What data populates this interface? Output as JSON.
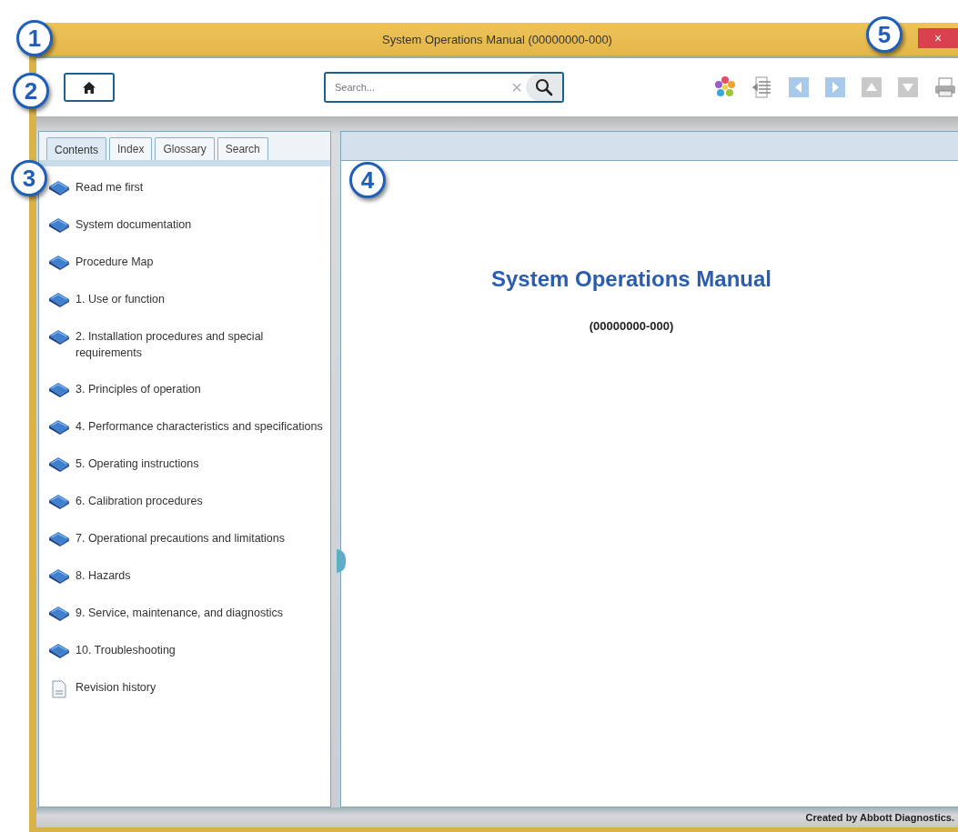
{
  "window": {
    "title": "System Operations Manual (00000000-000)",
    "close": "×"
  },
  "callouts": [
    "1",
    "2",
    "3",
    "4",
    "5"
  ],
  "search": {
    "placeholder": "Search...",
    "clear": "×"
  },
  "tabs": [
    {
      "label": "Contents",
      "selected": true
    },
    {
      "label": "Index",
      "selected": false
    },
    {
      "label": "Glossary",
      "selected": false
    },
    {
      "label": "Search",
      "selected": false
    }
  ],
  "contents": [
    {
      "label": "Read me first",
      "kind": "book"
    },
    {
      "label": "System documentation",
      "kind": "book"
    },
    {
      "label": "Procedure Map",
      "kind": "book"
    },
    {
      "label": "1. Use or function",
      "kind": "book"
    },
    {
      "label": "2. Installation procedures and special requirements",
      "kind": "book"
    },
    {
      "label": "3. Principles of operation",
      "kind": "book"
    },
    {
      "label": "4. Performance characteristics and specifications",
      "kind": "book"
    },
    {
      "label": "5. Operating instructions",
      "kind": "book"
    },
    {
      "label": "6. Calibration procedures",
      "kind": "book"
    },
    {
      "label": "7. Operational precautions and limitations",
      "kind": "book"
    },
    {
      "label": "8. Hazards",
      "kind": "book"
    },
    {
      "label": "9. Service, maintenance, and diagnostics",
      "kind": "book"
    },
    {
      "label": "10. Troubleshooting",
      "kind": "book"
    },
    {
      "label": "Revision history",
      "kind": "page"
    }
  ],
  "document": {
    "title": "System Operations Manual",
    "subtitle": "(00000000-000)"
  },
  "footer": "Created by Abbott Diagnostics."
}
